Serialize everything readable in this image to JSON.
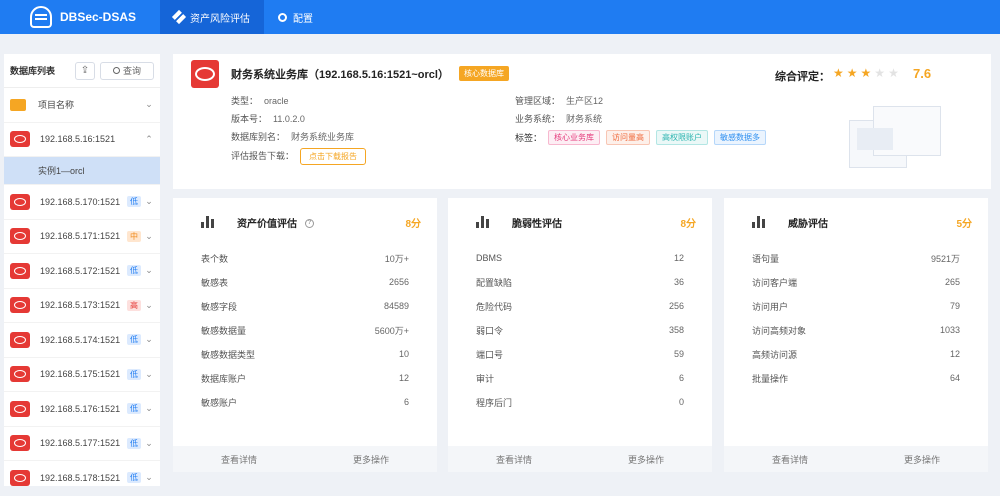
{
  "app": {
    "name": "DBSec-DSAS"
  },
  "nav": [
    {
      "label": "资产风险评估",
      "icon": "grid-icon",
      "active": true
    },
    {
      "label": "配置",
      "icon": "gear-icon",
      "active": false
    }
  ],
  "sidebar": {
    "title": "数据库列表",
    "search_label": "查询",
    "group": {
      "label": "项目名称"
    },
    "items": [
      {
        "label": "192.168.5.16:1521",
        "level": "",
        "expanded": true
      },
      {
        "label": "192.168.5.170:1521",
        "level": "低"
      },
      {
        "label": "192.168.5.171:1521",
        "level": "中"
      },
      {
        "label": "192.168.5.172:1521",
        "level": "低"
      },
      {
        "label": "192.168.5.173:1521",
        "level": "高"
      },
      {
        "label": "192.168.5.174:1521",
        "level": "低"
      },
      {
        "label": "192.168.5.175:1521",
        "level": "低"
      },
      {
        "label": "192.168.5.176:1521",
        "level": "低"
      },
      {
        "label": "192.168.5.177:1521",
        "level": "低"
      },
      {
        "label": "192.168.5.178:1521",
        "level": "低"
      }
    ],
    "instance": {
      "label": "实例1—orcl"
    }
  },
  "db": {
    "title": "财务系统业务库（192.168.5.16:1521~orcl）",
    "core_tag": "核心数据库",
    "type_label": "类型：",
    "type_value": "oracle",
    "version_label": "版本号：",
    "version_value": "11.0.2.0",
    "alias_label": "数据库别名：",
    "alias_value": "财务系统业务库",
    "report_label": "评估报告下载：",
    "report_button": "点击下载报告",
    "zone_label": "管理区域：",
    "zone_value": "生产区12",
    "system_label": "业务系统：",
    "system_value": "财务系统",
    "tags_label": "标签：",
    "tags": [
      "核心业务库",
      "访问量高",
      "高权限账户",
      "敏感数据多"
    ],
    "score_label": "综合评定：",
    "stars": 3,
    "stars_total": 5,
    "score": "7.6"
  },
  "cards": [
    {
      "title": "资产价值评估",
      "score": "8分",
      "rows": [
        {
          "label": "表个数",
          "value": "10万+"
        },
        {
          "label": "敏感表",
          "value": "2656"
        },
        {
          "label": "敏感字段",
          "value": "84589"
        },
        {
          "label": "敏感数据量",
          "value": "5600万+"
        },
        {
          "label": "敏感数据类型",
          "value": "10"
        },
        {
          "label": "数据库账户",
          "value": "12"
        },
        {
          "label": "敏感账户",
          "value": "6"
        }
      ],
      "footer": [
        "查看详情",
        "更多操作"
      ]
    },
    {
      "title": "脆弱性评估",
      "score": "8分",
      "rows": [
        {
          "label": "DBMS",
          "value": "12"
        },
        {
          "label": "配置缺陷",
          "value": "36"
        },
        {
          "label": "危险代码",
          "value": "256"
        },
        {
          "label": "弱口令",
          "value": "358"
        },
        {
          "label": "端口号",
          "value": "59"
        },
        {
          "label": "审计",
          "value": "6"
        },
        {
          "label": "程序后门",
          "value": "0"
        }
      ],
      "footer": [
        "查看详情",
        "更多操作"
      ]
    },
    {
      "title": "威胁评估",
      "score": "5分",
      "rows": [
        {
          "label": "语句量",
          "value": "9521万"
        },
        {
          "label": "访问客户端",
          "value": "265"
        },
        {
          "label": "访问用户",
          "value": "79"
        },
        {
          "label": "访问高频对象",
          "value": "1033"
        },
        {
          "label": "高频访问源",
          "value": "12"
        },
        {
          "label": "批量操作",
          "value": "64"
        }
      ],
      "footer": [
        "查看详情",
        "更多操作"
      ]
    }
  ],
  "colors": {
    "primary": "#1f7cf2",
    "accent": "#f5a623",
    "oracle": "#e53935"
  }
}
